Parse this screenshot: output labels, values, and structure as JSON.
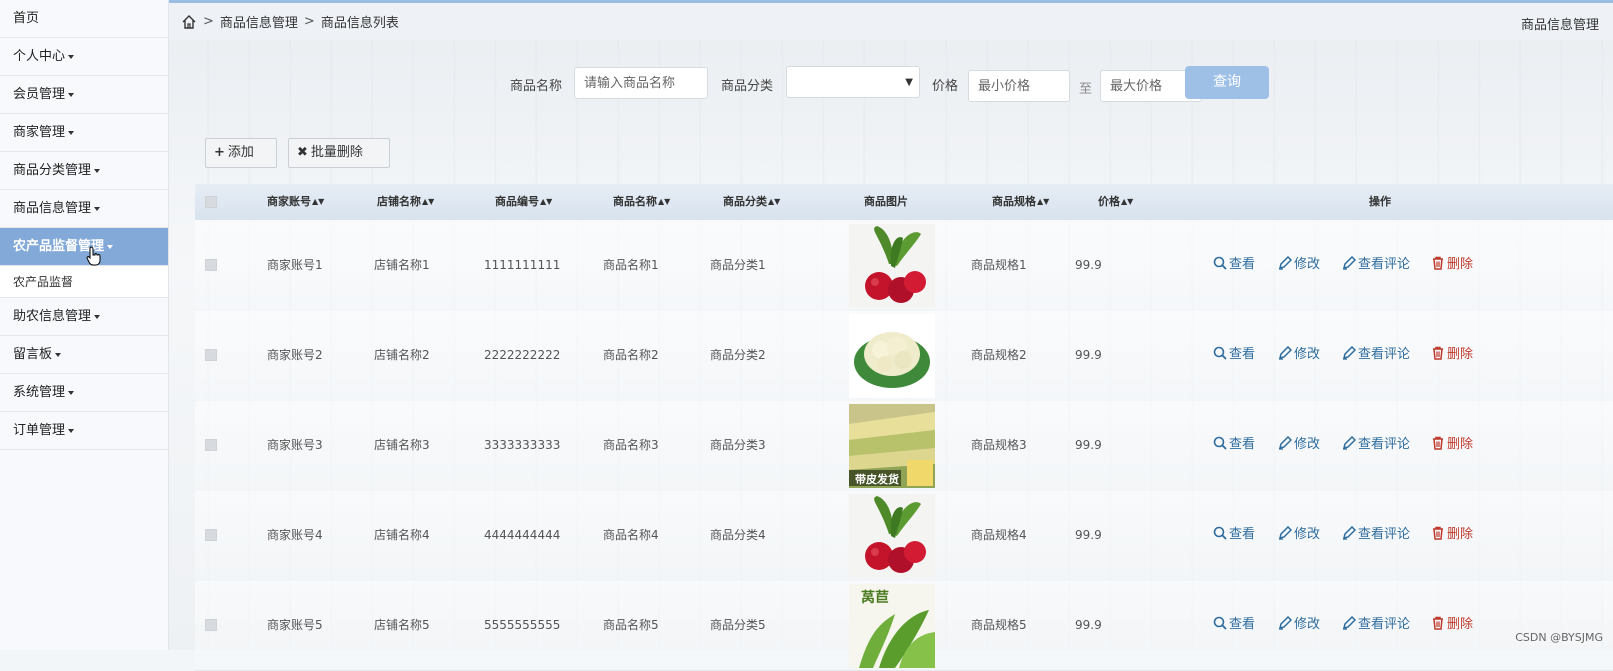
{
  "sidebar": {
    "items": [
      {
        "label": "首页",
        "has_caret": false
      },
      {
        "label": "个人中心",
        "has_caret": true
      },
      {
        "label": "会员管理",
        "has_caret": true
      },
      {
        "label": "商家管理",
        "has_caret": true
      },
      {
        "label": "商品分类管理",
        "has_caret": true
      },
      {
        "label": "商品信息管理",
        "has_caret": true
      },
      {
        "label": "农产品监督管理",
        "has_caret": true,
        "active": true
      },
      {
        "label": "农产品监督",
        "sub": true
      },
      {
        "label": "助农信息管理",
        "has_caret": true
      },
      {
        "label": "留言板",
        "has_caret": true
      },
      {
        "label": "系统管理",
        "has_caret": true
      },
      {
        "label": "订单管理",
        "has_caret": true
      }
    ]
  },
  "header": {
    "breadcrumb": [
      "商品信息管理",
      "商品信息列表"
    ],
    "right_title": "商品信息管理"
  },
  "search": {
    "name_label": "商品名称",
    "name_placeholder": "请输入商品名称",
    "category_label": "商品分类",
    "category_value": "",
    "price_label": "价格",
    "min_placeholder": "最小价格",
    "to_label": "至",
    "max_placeholder": "最大价格",
    "query_label": "查询"
  },
  "toolbar": {
    "add_label": "添加",
    "batch_delete_label": "批量删除"
  },
  "table": {
    "columns": [
      "商家账号",
      "店铺名称",
      "商品编号",
      "商品名称",
      "商品分类",
      "商品图片",
      "商品规格",
      "价格",
      "操作"
    ],
    "rows": [
      {
        "merchant": "商家账号1",
        "shop": "店铺名称1",
        "code": "1111111111",
        "name": "商品名称1",
        "category": "商品分类1",
        "image": "beet-icon",
        "spec": "商品规格1",
        "price": "99.9"
      },
      {
        "merchant": "商家账号2",
        "shop": "店铺名称2",
        "code": "2222222222",
        "name": "商品名称2",
        "category": "商品分类2",
        "image": "cauliflower-icon",
        "spec": "商品规格2",
        "price": "99.9"
      },
      {
        "merchant": "商家账号3",
        "shop": "店铺名称3",
        "code": "3333333333",
        "name": "商品名称3",
        "category": "商品分类3",
        "image": "corn-icon",
        "image_caption": "带皮发货",
        "spec": "商品规格3",
        "price": "99.9"
      },
      {
        "merchant": "商家账号4",
        "shop": "店铺名称4",
        "code": "4444444444",
        "name": "商品名称4",
        "category": "商品分类4",
        "image": "beet-icon",
        "spec": "商品规格4",
        "price": "99.9"
      },
      {
        "merchant": "商家账号5",
        "shop": "店铺名称5",
        "code": "5555555555",
        "name": "商品名称5",
        "category": "商品分类5",
        "image": "greens-icon",
        "image_caption": "莴苣",
        "spec": "商品规格5",
        "price": "99.9"
      }
    ],
    "actions": {
      "view": "查看",
      "edit": "修改",
      "view_comments": "查看评论",
      "delete": "删除"
    }
  },
  "watermark": "CSDN @BYSJMG"
}
